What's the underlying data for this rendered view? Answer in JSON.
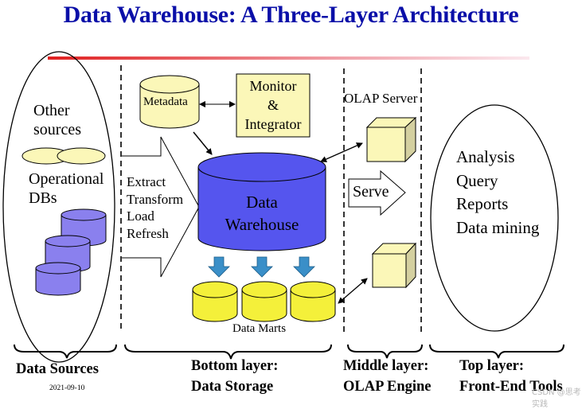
{
  "title": "Data Warehouse: A Three-Layer Architecture",
  "data_sources": {
    "other_sources_label": [
      "Other",
      "sources"
    ],
    "operational_dbs_label": [
      "Operational",
      "DBs"
    ]
  },
  "etl": {
    "lines": [
      "Extract",
      "Transform",
      "Load",
      "Refresh"
    ]
  },
  "metadata_label": "Metadata",
  "monitor": {
    "lines": [
      "Monitor",
      "&",
      "Integrator"
    ]
  },
  "warehouse": {
    "lines": [
      "Data",
      "Warehouse"
    ]
  },
  "data_marts_label": "Data Marts",
  "olap_server_label": "OLAP Server",
  "serve_label": "Serve",
  "front_end": {
    "lines": [
      "Analysis",
      "Query",
      "Reports",
      "Data mining"
    ]
  },
  "layers": [
    {
      "lines": [
        "Data Sources"
      ]
    },
    {
      "lines": [
        "Bottom layer:",
        "Data Storage"
      ]
    },
    {
      "lines": [
        "Middle layer:",
        "OLAP Engine"
      ]
    },
    {
      "lines": [
        "Top layer:",
        "Front-End Tools"
      ]
    }
  ],
  "date": "2021-09-10",
  "watermark": "CSDN @思考实践",
  "colors": {
    "title": "#0a0fa8",
    "warehouse_blue": "#5555ee",
    "pale_yellow": "#fbf7b8",
    "mart_yellow": "#f4f03a",
    "source_purple": "#8a80ee",
    "down_arrow": "#3a8fc8"
  }
}
